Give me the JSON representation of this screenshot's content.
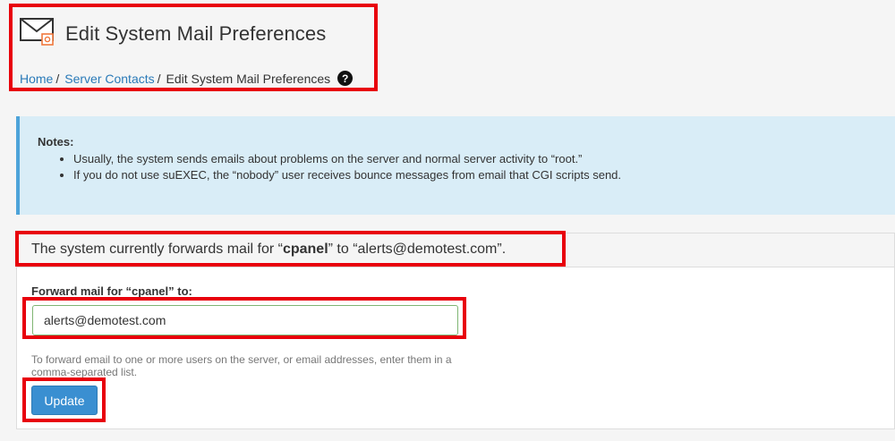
{
  "header": {
    "title": "Edit System Mail Preferences",
    "icon": "mail-gear-icon",
    "breadcrumb": {
      "home": "Home",
      "separator": "/",
      "server_contacts": "Server Contacts",
      "current": "Edit System Mail Preferences"
    },
    "help_glyph": "?"
  },
  "notes": {
    "title": "Notes:",
    "items": [
      "Usually, the system sends emails about problems on the server and normal server activity to “root.”",
      "If you do not use suEXEC, the “nobody” user receives bounce messages from email that CGI scripts send."
    ]
  },
  "status": {
    "prefix": "The system currently forwards mail for “",
    "user": "cpanel",
    "suffix": "” to “alerts@demotest.com”."
  },
  "form": {
    "label": "Forward mail for “cpanel” to:",
    "input_value": "alerts@demotest.com",
    "help_text": "To forward email to one or more users on the server, or email addresses, enter them in a comma-separated list.",
    "submit_label": "Update"
  },
  "colors": {
    "highlight": "#e8000b",
    "link": "#2a7ab8",
    "primary_button": "#3a8fd1",
    "notes_background": "#d9edf7"
  }
}
